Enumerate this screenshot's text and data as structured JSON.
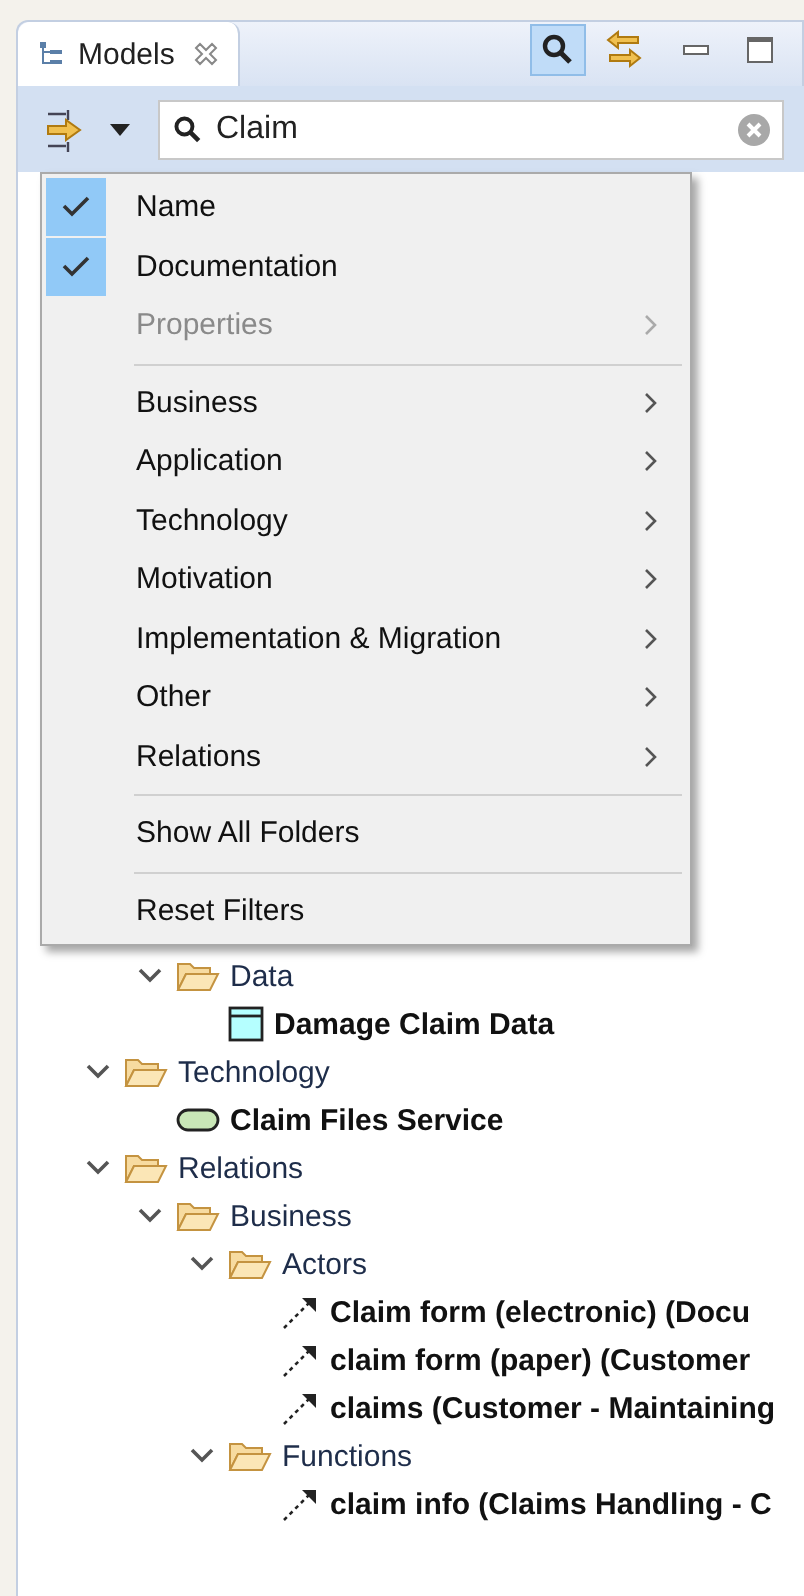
{
  "view_tab": {
    "title": "Models"
  },
  "toolbar": {
    "search_toggle": {
      "selected": true
    }
  },
  "search": {
    "value": "Claim"
  },
  "filter_menu": {
    "items": [
      {
        "kind": "check",
        "label": "Name",
        "checked": true,
        "disabled": false
      },
      {
        "kind": "check",
        "label": "Documentation",
        "checked": true,
        "disabled": false
      },
      {
        "kind": "submenu",
        "label": "Properties",
        "disabled": true
      },
      {
        "kind": "separator"
      },
      {
        "kind": "submenu",
        "label": "Business",
        "disabled": false
      },
      {
        "kind": "submenu",
        "label": "Application",
        "disabled": false
      },
      {
        "kind": "submenu",
        "label": "Technology",
        "disabled": false
      },
      {
        "kind": "submenu",
        "label": "Motivation",
        "disabled": false
      },
      {
        "kind": "submenu",
        "label": "Implementation & Migration",
        "disabled": false
      },
      {
        "kind": "submenu",
        "label": "Other",
        "disabled": false
      },
      {
        "kind": "submenu",
        "label": "Relations",
        "disabled": false
      },
      {
        "kind": "separator"
      },
      {
        "kind": "action",
        "label": "Show All Folders",
        "disabled": false
      },
      {
        "kind": "separator"
      },
      {
        "kind": "action",
        "label": "Reset Filters",
        "disabled": false
      }
    ]
  },
  "tree": {
    "items": [
      {
        "children": [
          {
            "kind": "folder",
            "label": "Data",
            "expanded": true,
            "children": [
              {
                "kind": "data-object",
                "label": "Damage Claim Data"
              }
            ]
          }
        ]
      },
      {
        "kind": "folder",
        "label": "Technology",
        "expanded": true,
        "children": [
          {
            "kind": "service",
            "label": "Claim Files Service"
          }
        ]
      },
      {
        "kind": "folder",
        "label": "Relations",
        "expanded": true,
        "children": [
          {
            "kind": "folder",
            "label": "Business",
            "expanded": true,
            "children": [
              {
                "kind": "folder",
                "label": "Actors",
                "expanded": true,
                "children": [
                  {
                    "kind": "relation",
                    "label": "Claim form (electronic) (Docu"
                  },
                  {
                    "kind": "relation",
                    "label": "claim form (paper) (Customer"
                  },
                  {
                    "kind": "relation",
                    "label": "claims (Customer - Maintaining"
                  }
                ]
              },
              {
                "kind": "folder",
                "label": "Functions",
                "expanded": true,
                "children": [
                  {
                    "kind": "relation",
                    "label": "claim info (Claims Handling - C"
                  }
                ]
              }
            ]
          }
        ]
      }
    ]
  }
}
